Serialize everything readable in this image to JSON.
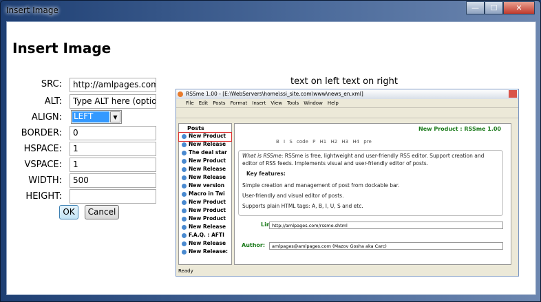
{
  "window": {
    "title": "Insert Image",
    "minimize": "—",
    "maximize": "☐",
    "close": "✕"
  },
  "heading": "Insert Image",
  "form": {
    "src_label": "SRC:",
    "src_value": "http://amlpages.com/i",
    "alt_label": "ALT:",
    "alt_placeholder": "Type ALT here (optional)",
    "align_label": "ALIGN:",
    "align_value": "LEFT",
    "border_label": "BORDER:",
    "border_value": "0",
    "hspace_label": "HSPACE:",
    "hspace_value": "1",
    "vspace_label": "VSPACE:",
    "vspace_value": "1",
    "width_label": "WIDTH:",
    "width_value": "500",
    "height_label": "HEIGHT:",
    "height_value": "",
    "ok": "OK",
    "cancel": "Cancel"
  },
  "preview": {
    "caption": "text on left  text on right",
    "title": "RSSme 1.00 - [E:\\WebServers\\home\\ssi_site.com\\www\\news_en.xml]",
    "menu": [
      "File",
      "Edit",
      "Posts",
      "Format",
      "Insert",
      "View",
      "Tools",
      "Window",
      "Help"
    ],
    "posts_header": "Posts",
    "posts": [
      "New Product",
      "New Release",
      "The deal star",
      "New Product",
      "New Release",
      "New Release",
      "New version",
      "Macro in Twi",
      "New Product",
      "New Product",
      "New Product",
      "New Release",
      "F.A.Q. : AFTI",
      "New Release",
      "New Release:"
    ],
    "post_title": "New Product : RSSme 1.00",
    "toolbar": "B  I  S  code  P  H1 H2 H3 H4  pre",
    "body_intro_em": "What is RSSme",
    "body_intro": ": RSSme is free, lightweight and user-friendly RSS editor. Support creation and editor of RSS feeds. Implements visual and user-friendly editor of posts.",
    "key_features": "Key features:",
    "features": [
      "Simple creation and management of post from dockable bar.",
      "User-friendly and visual editor of posts.",
      "Supports plain HTML tags: A, B, I, U, S and etc."
    ],
    "link_label": "Link:",
    "link_value": "http://amlpages.com/rssme.shtml",
    "author_label": "Author:",
    "author_value": "amlpages@amlpages.com (Mazov Gosha aka Carc)",
    "status": "Ready"
  }
}
